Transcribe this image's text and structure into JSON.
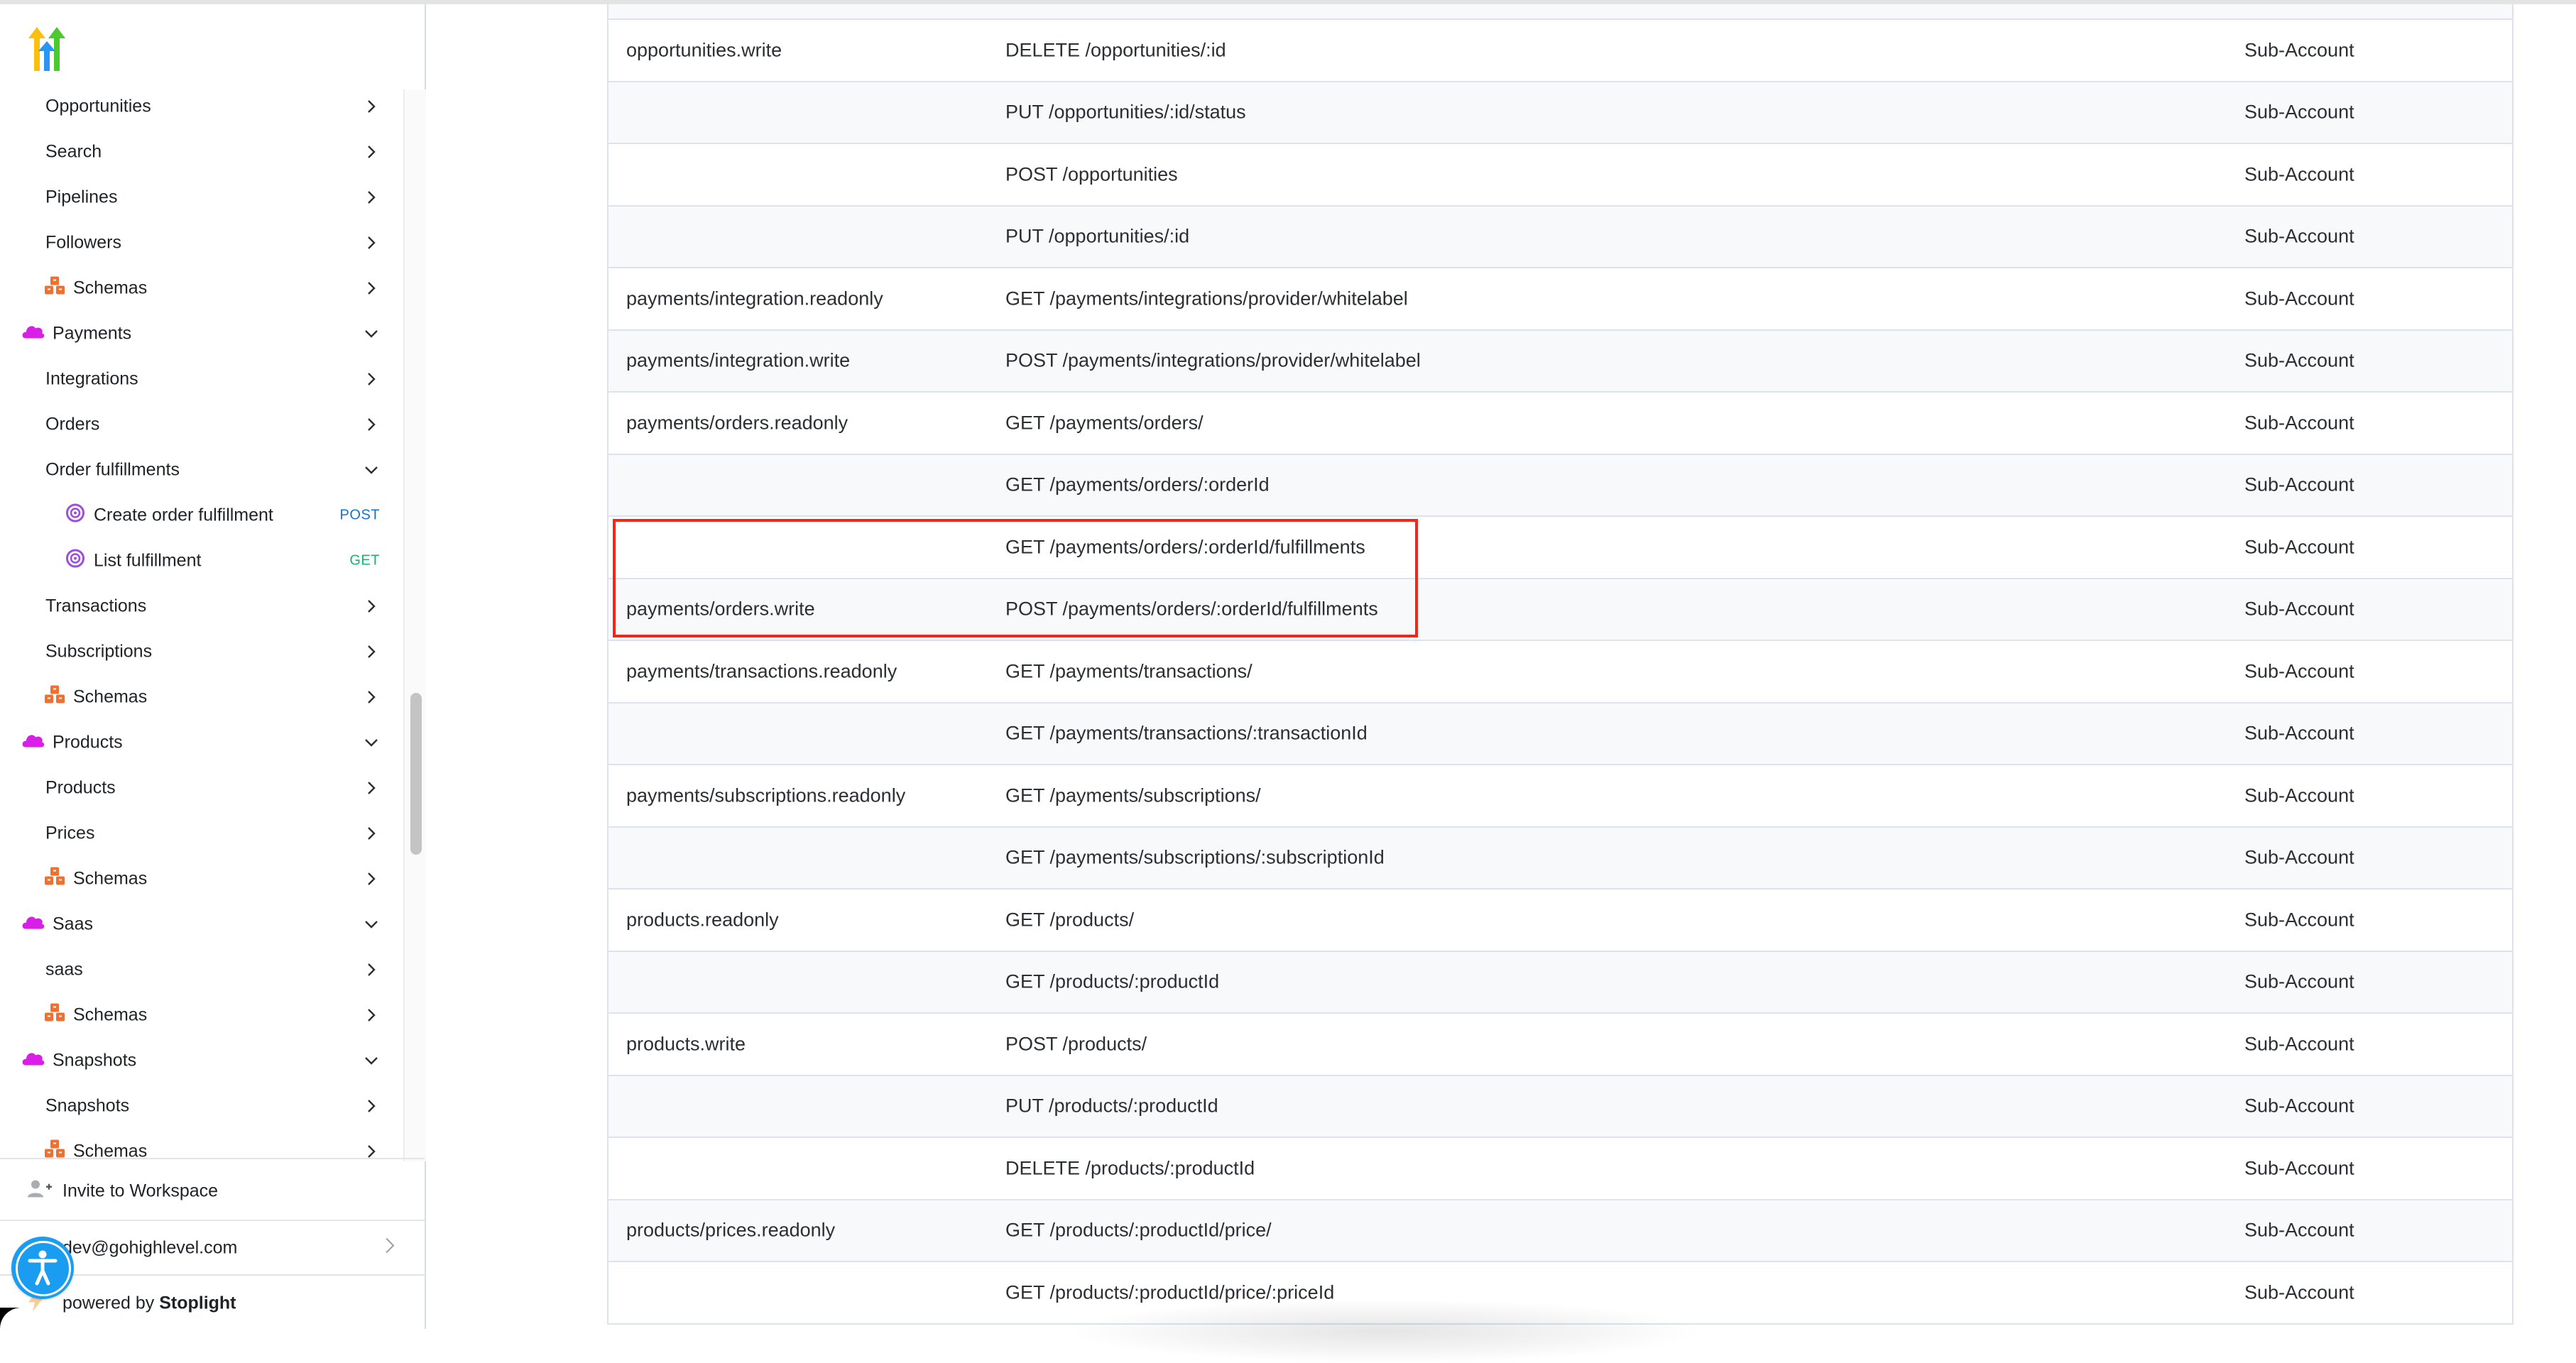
{
  "sidebar": {
    "logo": "gohighlevel-logo",
    "items": [
      {
        "label": "Opportunities",
        "level": 1,
        "icon": null,
        "expanded": false
      },
      {
        "label": "Search",
        "level": 1,
        "icon": null,
        "expanded": false
      },
      {
        "label": "Pipelines",
        "level": 1,
        "icon": null,
        "expanded": false
      },
      {
        "label": "Followers",
        "level": 1,
        "icon": null,
        "expanded": false
      },
      {
        "label": "Schemas",
        "level": 1,
        "icon": "cubes-icon",
        "expanded": false
      },
      {
        "label": "Payments",
        "level": 0,
        "icon": "cloud-icon",
        "expanded": true
      },
      {
        "label": "Integrations",
        "level": 1,
        "icon": null,
        "expanded": false
      },
      {
        "label": "Orders",
        "level": 1,
        "icon": null,
        "expanded": false
      },
      {
        "label": "Order fulfillments",
        "level": 1,
        "icon": null,
        "expanded": true
      },
      {
        "label": "Create order fulfillment",
        "level": 2,
        "icon": "target-icon",
        "method": "POST"
      },
      {
        "label": "List fulfillment",
        "level": 2,
        "icon": "target-icon",
        "method": "GET"
      },
      {
        "label": "Transactions",
        "level": 1,
        "icon": null,
        "expanded": false
      },
      {
        "label": "Subscriptions",
        "level": 1,
        "icon": null,
        "expanded": false
      },
      {
        "label": "Schemas",
        "level": 1,
        "icon": "cubes-icon",
        "expanded": false
      },
      {
        "label": "Products",
        "level": 0,
        "icon": "cloud-icon",
        "expanded": true
      },
      {
        "label": "Products",
        "level": 1,
        "icon": null,
        "expanded": false
      },
      {
        "label": "Prices",
        "level": 1,
        "icon": null,
        "expanded": false
      },
      {
        "label": "Schemas",
        "level": 1,
        "icon": "cubes-icon",
        "expanded": false
      },
      {
        "label": "Saas",
        "level": 0,
        "icon": "cloud-icon",
        "expanded": true
      },
      {
        "label": "saas",
        "level": 1,
        "icon": null,
        "expanded": false
      },
      {
        "label": "Schemas",
        "level": 1,
        "icon": "cubes-icon",
        "expanded": false
      },
      {
        "label": "Snapshots",
        "level": 0,
        "icon": "cloud-icon",
        "expanded": true
      },
      {
        "label": "Snapshots",
        "level": 1,
        "icon": null,
        "expanded": false
      },
      {
        "label": "Schemas",
        "level": 1,
        "icon": "cubes-icon",
        "expanded": false
      }
    ],
    "footer": {
      "invite_label": "Invite to Workspace",
      "user_email": "dev@gohighlevel.com",
      "powered_prefix": "powered by ",
      "powered_brand": "Stoplight"
    }
  },
  "colors": {
    "post": "#1a6fd1",
    "get": "#1db26b",
    "cloud": "#d91ee8",
    "cubes": "#f07030",
    "target": "#9b4de0",
    "highlight": "#f0271a",
    "accessibility": "#1a9cf0"
  },
  "table": {
    "rows": [
      {
        "scope": "opportunities.write",
        "endpoint": "DELETE /opportunities/:id",
        "access": "Sub-Account"
      },
      {
        "scope": "",
        "endpoint": "PUT /opportunities/:id/status",
        "access": "Sub-Account"
      },
      {
        "scope": "",
        "endpoint": "POST /opportunities",
        "access": "Sub-Account"
      },
      {
        "scope": "",
        "endpoint": "PUT /opportunities/:id",
        "access": "Sub-Account"
      },
      {
        "scope": "payments/integration.readonly",
        "endpoint": "GET /payments/integrations/provider/whitelabel",
        "access": "Sub-Account"
      },
      {
        "scope": "payments/integration.write",
        "endpoint": "POST /payments/integrations/provider/whitelabel",
        "access": "Sub-Account"
      },
      {
        "scope": "payments/orders.readonly",
        "endpoint": "GET /payments/orders/",
        "access": "Sub-Account"
      },
      {
        "scope": "",
        "endpoint": "GET /payments/orders/:orderId",
        "access": "Sub-Account"
      },
      {
        "scope": "",
        "endpoint": "GET /payments/orders/:orderId/fulfillments",
        "access": "Sub-Account"
      },
      {
        "scope": "payments/orders.write",
        "endpoint": "POST /payments/orders/:orderId/fulfillments",
        "access": "Sub-Account"
      },
      {
        "scope": "payments/transactions.readonly",
        "endpoint": "GET /payments/transactions/",
        "access": "Sub-Account"
      },
      {
        "scope": "",
        "endpoint": "GET /payments/transactions/:transactionId",
        "access": "Sub-Account"
      },
      {
        "scope": "payments/subscriptions.readonly",
        "endpoint": "GET /payments/subscriptions/",
        "access": "Sub-Account"
      },
      {
        "scope": "",
        "endpoint": "GET /payments/subscriptions/:subscriptionId",
        "access": "Sub-Account"
      },
      {
        "scope": "products.readonly",
        "endpoint": "GET /products/",
        "access": "Sub-Account"
      },
      {
        "scope": "",
        "endpoint": "GET /products/:productId",
        "access": "Sub-Account"
      },
      {
        "scope": "products.write",
        "endpoint": "POST /products/",
        "access": "Sub-Account"
      },
      {
        "scope": "",
        "endpoint": "PUT /products/:productId",
        "access": "Sub-Account"
      },
      {
        "scope": "",
        "endpoint": "DELETE /products/:productId",
        "access": "Sub-Account"
      },
      {
        "scope": "products/prices.readonly",
        "endpoint": "GET /products/:productId/price/",
        "access": "Sub-Account"
      },
      {
        "scope": "",
        "endpoint": "GET /products/:productId/price/:priceId",
        "access": "Sub-Account"
      }
    ],
    "highlighted_rows": [
      8,
      9
    ]
  }
}
